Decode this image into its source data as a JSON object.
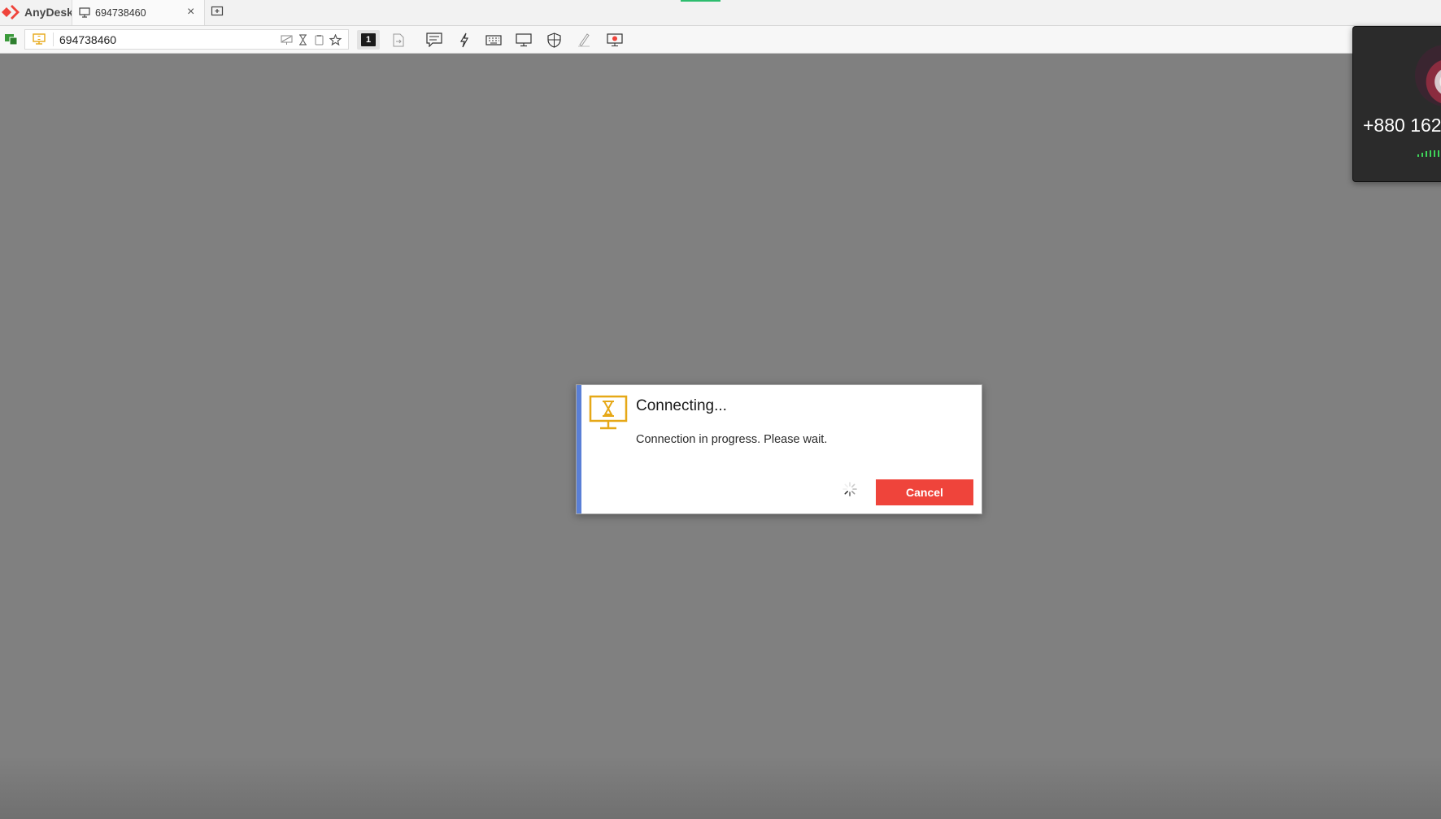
{
  "app": {
    "name": "AnyDesk"
  },
  "tabs": [
    {
      "label": "694738460",
      "icon": "monitor-icon"
    }
  ],
  "toolbar": {
    "address_value": "694738460",
    "monitor_number": "1",
    "icons": [
      "status-icon",
      "address-monitor-icon",
      "no-screen-icon",
      "hourglass-icon",
      "clipboard-icon",
      "star-icon",
      "monitor-select-icon",
      "file-transfer-icon",
      "chat-icon",
      "actions-icon",
      "keyboard-icon",
      "display-icon",
      "permissions-icon",
      "whiteboard-icon",
      "record-icon"
    ]
  },
  "dialog": {
    "title": "Connecting...",
    "message": "Connection in progress. Please wait.",
    "cancel_label": "Cancel",
    "icon": "hourglass-monitor-icon"
  },
  "call_widget": {
    "number": "+880 162"
  },
  "colors": {
    "accent_red": "#ef443b",
    "dialog_accent": "#5a7fd6",
    "icon_yellow": "#e6a817",
    "background": "#808080"
  }
}
